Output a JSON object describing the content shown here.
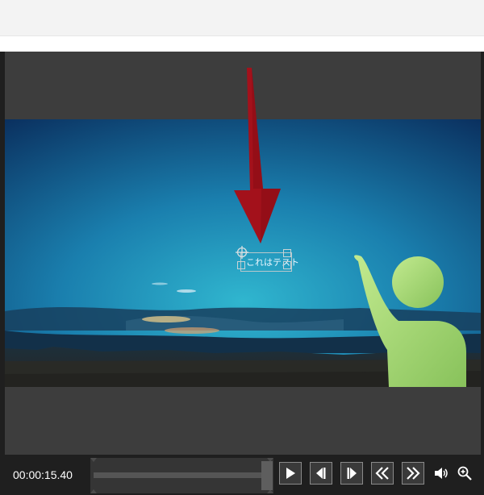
{
  "player": {
    "timecode": "00:00:15.40",
    "overlay_text": "これはテスト",
    "progress": 0.93
  },
  "controls": {
    "buttons": [
      {
        "name": "play-button",
        "icon": "play-icon"
      },
      {
        "name": "previous-frame-button",
        "icon": "step-back-icon"
      },
      {
        "name": "next-frame-button",
        "icon": "step-forward-icon"
      },
      {
        "name": "rewind-button",
        "icon": "double-chevron-left-icon"
      },
      {
        "name": "fast-forward-button",
        "icon": "double-chevron-right-icon"
      }
    ],
    "volume_icon": "speaker-icon",
    "zoom_icon": "zoom-in-icon"
  },
  "colors": {
    "arrow": "#a3111b",
    "figure": "#a6d873",
    "sky_top": "#0b3a6f",
    "sky_mid": "#1f8fb6",
    "panel": "#3d3d3d",
    "controls_bg": "#1f1f1f"
  }
}
